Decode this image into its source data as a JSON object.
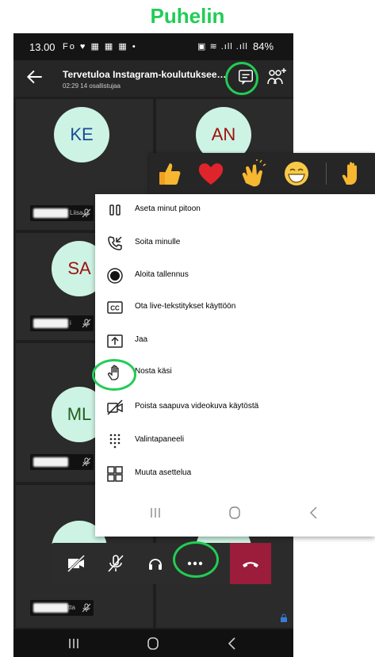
{
  "heading": "Puhelin",
  "status": {
    "time": "13.00",
    "battery": "84%"
  },
  "call": {
    "title": "Tervetuloa Instagram-koulutukseen to 2...",
    "subtitle": "02:29 14 osallistujaa"
  },
  "participants": [
    {
      "initials": "KE",
      "name_fragment": "Liisa"
    },
    {
      "initials": "AN",
      "name_fragment": ""
    },
    {
      "initials": "SA",
      "name_fragment": "i"
    },
    {
      "initials": "ML",
      "name_fragment": ""
    },
    {
      "initials": "",
      "name_fragment": "tta"
    }
  ],
  "reactions": [
    "thumbs-up",
    "heart",
    "clapping-hands",
    "laughing-face",
    "raised-hand"
  ],
  "menu": {
    "items": [
      {
        "icon": "pause-icon",
        "label": "Aseta minut pitoon"
      },
      {
        "icon": "phone-callback-icon",
        "label": "Soita minulle"
      },
      {
        "icon": "record-icon",
        "label": "Aloita tallennus"
      },
      {
        "icon": "captions-icon",
        "label": "Ota live-tekstitykset käyttöön"
      },
      {
        "icon": "share-icon",
        "label": "Jaa"
      },
      {
        "icon": "raise-hand-icon",
        "label": "Nosta käsi"
      },
      {
        "icon": "video-off-icon",
        "label": "Poista saapuva videokuva käytöstä"
      },
      {
        "icon": "dialpad-icon",
        "label": "Valintapaneeli"
      },
      {
        "icon": "layout-grid-icon",
        "label": "Muuta asettelua"
      }
    ]
  },
  "colors": {
    "highlight": "#22cc55",
    "hangup": "#9b1c3b",
    "avatar_bg": "#cdf3e4"
  }
}
